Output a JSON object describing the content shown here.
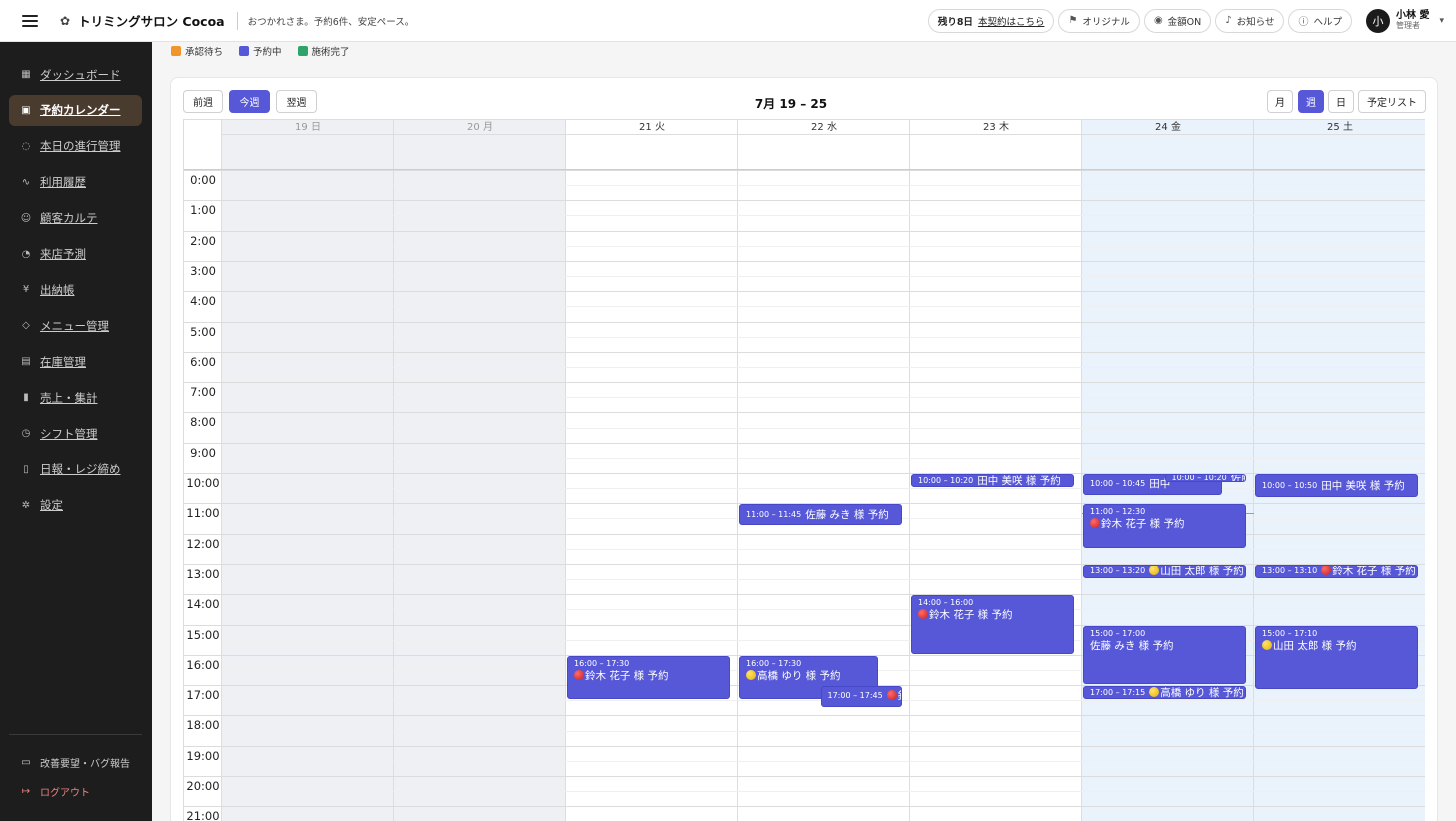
{
  "header": {
    "brand": "トリミングサロン Cocoa",
    "greeting": "おつかれさま。予約6件、安定ペース。",
    "trial_days": "残り8日",
    "contract_link": "本契約はこちら",
    "original_label": "オリジナル",
    "amount_label": "金額ON",
    "notice_label": "お知らせ",
    "help_label": "ヘルプ",
    "user_initial": "小",
    "user_name": "小林 愛",
    "user_role": "管理者"
  },
  "sidebar": {
    "items": [
      {
        "label": "ダッシュボード",
        "icon": "dashboard-icon"
      },
      {
        "label": "予約カレンダー",
        "icon": "calendar-icon",
        "active": true
      },
      {
        "label": "本日の進行管理",
        "icon": "progress-icon"
      },
      {
        "label": "利用履歴",
        "icon": "activity-icon"
      },
      {
        "label": "顧客カルテ",
        "icon": "users-icon"
      },
      {
        "label": "来店予測",
        "icon": "bell-icon"
      },
      {
        "label": "出納帳",
        "icon": "yen-icon"
      },
      {
        "label": "メニュー管理",
        "icon": "tag-icon"
      },
      {
        "label": "在庫管理",
        "icon": "box-icon"
      },
      {
        "label": "売上・集計",
        "icon": "bar-chart-icon"
      },
      {
        "label": "シフト管理",
        "icon": "clock-icon"
      },
      {
        "label": "日報・レジ締め",
        "icon": "clipboard-icon"
      },
      {
        "label": "設定",
        "icon": "gear-icon"
      }
    ],
    "feedback_label": "改善要望・バグ報告",
    "logout_label": "ログアウト"
  },
  "legend": [
    {
      "label": "承認待ち",
      "color": "#f0952b"
    },
    {
      "label": "予約中",
      "color": "#5658d8"
    },
    {
      "label": "施術完了",
      "color": "#2fa46a"
    }
  ],
  "toolbar": {
    "prev": "前週",
    "this": "今週",
    "next": "翌週",
    "title": "7月 19 – 25",
    "month": "月",
    "week": "週",
    "day": "日",
    "list": "予定リスト"
  },
  "days": [
    {
      "label": "19 日",
      "past": true
    },
    {
      "label": "20 月",
      "past": true
    },
    {
      "label": "21 火"
    },
    {
      "label": "22 水"
    },
    {
      "label": "23 木"
    },
    {
      "label": "24 金",
      "today": true
    },
    {
      "label": "25 土",
      "future_highlight": true
    }
  ],
  "hours": [
    "0:00",
    "1:00",
    "2:00",
    "3:00",
    "4:00",
    "5:00",
    "6:00",
    "7:00",
    "8:00",
    "9:00",
    "10:00",
    "11:00",
    "12:00",
    "13:00",
    "14:00",
    "15:00",
    "16:00",
    "17:00",
    "18:00",
    "19:00",
    "20:00",
    "21:00"
  ],
  "events": [
    {
      "day": 2,
      "start": 16.0,
      "end": 17.5,
      "time": "16:00 – 17:30",
      "name": "鈴木 花子 様 予約",
      "dot": "red",
      "layout": "block"
    },
    {
      "day": 3,
      "start": 11.0,
      "end": 11.75,
      "time": "11:00 – 11:45",
      "name": "佐藤 みき 様 予約",
      "layout": "inline"
    },
    {
      "day": 3,
      "start": 16.0,
      "end": 17.5,
      "time": "16:00 – 17:30",
      "name": "高橋 ゆり 様 予約",
      "dot": "yellow",
      "layout": "block",
      "width": 0.85
    },
    {
      "day": 3,
      "start": 17.0,
      "end": 17.75,
      "time": "17:00 – 17:45",
      "name": "鈴木 花子 様 予約",
      "dot": "red",
      "layout": "inline",
      "offset": 0.5
    },
    {
      "day": 4,
      "start": 10.0,
      "end": 10.5,
      "time": "10:00 – 10:20",
      "name": "田中 美咲 様 予約",
      "layout": "inline"
    },
    {
      "day": 4,
      "start": 14.0,
      "end": 16.0,
      "time": "14:00 – 16:00",
      "name": "鈴木 花子 様 予約",
      "dot": "red",
      "layout": "block"
    },
    {
      "day": 5,
      "start": 10.0,
      "end": 10.75,
      "time": "10:00 – 10:45",
      "name": "田中",
      "layout": "inline",
      "width": 0.85
    },
    {
      "day": 5,
      "start": 10.0,
      "end": 10.33,
      "time": "10:00 – 10:20",
      "name": "佐藤",
      "layout": "inline",
      "offset": 0.5
    },
    {
      "day": 5,
      "start": 11.0,
      "end": 12.5,
      "time": "11:00 – 12:30",
      "name": "鈴木 花子 様 予約",
      "dot": "red",
      "layout": "block"
    },
    {
      "day": 5,
      "start": 13.0,
      "end": 13.5,
      "time": "13:00 – 13:20",
      "name": "山田 太郎 様 予約",
      "dot": "yellow",
      "layout": "inline"
    },
    {
      "day": 5,
      "start": 15.0,
      "end": 17.0,
      "time": "15:00 – 17:00",
      "name": "佐藤 みき 様 予約",
      "layout": "block"
    },
    {
      "day": 5,
      "start": 17.0,
      "end": 17.5,
      "time": "17:00 – 17:15",
      "name": "高橋 ゆり 様 予約",
      "dot": "yellow",
      "layout": "inline"
    },
    {
      "day": 6,
      "start": 10.0,
      "end": 10.83,
      "time": "10:00 – 10:50",
      "name": "田中 美咲 様 予約",
      "layout": "inline"
    },
    {
      "day": 6,
      "start": 13.0,
      "end": 13.5,
      "time": "13:00 – 13:10",
      "name": "鈴木 花子 様 予約",
      "dot": "red",
      "layout": "inline"
    },
    {
      "day": 6,
      "start": 15.0,
      "end": 17.17,
      "time": "15:00 – 17:10",
      "name": "山田 太郎 様 予約",
      "dot": "yellow",
      "layout": "block"
    }
  ],
  "now_hour": 11.33,
  "colors": {
    "accent": "#5658d8",
    "today_bg": "#eaf2fc",
    "past_bg": "#eef0f3"
  }
}
